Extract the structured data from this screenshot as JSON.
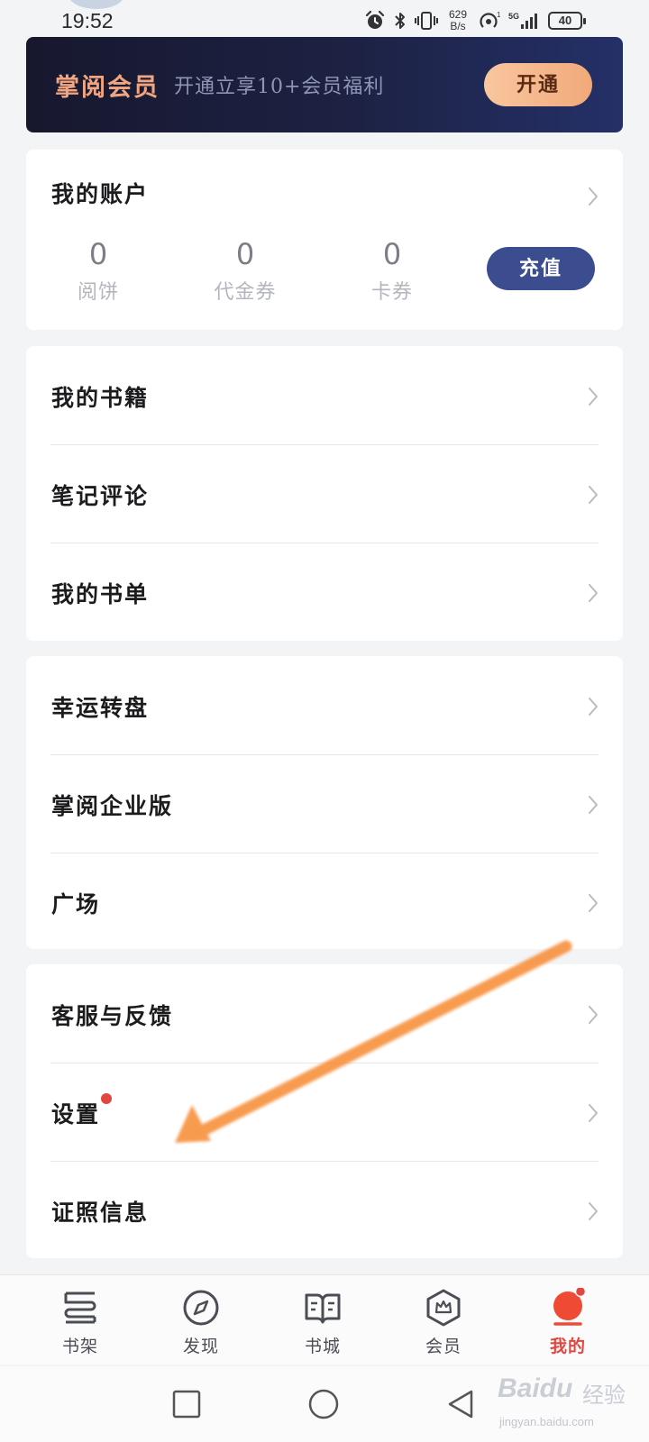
{
  "status_bar": {
    "time": "19:52",
    "net_speed_value": "629",
    "net_speed_unit": "B/s",
    "signal_tech": "5G",
    "sim_slot": "1",
    "battery": "40"
  },
  "vip_banner": {
    "title": "掌阅会员",
    "subtitle": "开通立享10+会员福利",
    "button_label": "开通"
  },
  "account": {
    "header": "我的账户",
    "stats": [
      {
        "value": "0",
        "label": "阅饼"
      },
      {
        "value": "0",
        "label": "代金券"
      },
      {
        "value": "0",
        "label": "卡券"
      }
    ],
    "recharge_label": "充值"
  },
  "menu_groups": [
    {
      "items": [
        {
          "label": "我的书籍"
        },
        {
          "label": "笔记评论"
        },
        {
          "label": "我的书单"
        }
      ]
    },
    {
      "items": [
        {
          "label": "幸运转盘"
        },
        {
          "label": "掌阅企业版"
        },
        {
          "label": "广场"
        }
      ]
    },
    {
      "items": [
        {
          "label": "客服与反馈"
        },
        {
          "label": "设置"
        },
        {
          "label": "证照信息"
        }
      ]
    }
  ],
  "tab_bar": {
    "tabs": [
      {
        "label": "书架",
        "icon": "bookshelf-icon"
      },
      {
        "label": "发现",
        "icon": "compass-icon"
      },
      {
        "label": "书城",
        "icon": "book-icon"
      },
      {
        "label": "会员",
        "icon": "crown-hexagon-icon"
      },
      {
        "label": "我的",
        "icon": "profile-icon"
      }
    ],
    "active_tab": "我的"
  },
  "nav_bar": {
    "buttons": [
      "recent-apps-icon",
      "home-icon",
      "back-icon"
    ]
  },
  "watermark": {
    "brand": "Baidu",
    "brand_cn": "经验",
    "url": "jingyan.baidu.com"
  },
  "colors": {
    "accent_red": "#e2473f",
    "vip_gold": "#f2a57f",
    "recharge_blue": "#3b4c8f",
    "annotation_arrow": "#f7913d"
  }
}
